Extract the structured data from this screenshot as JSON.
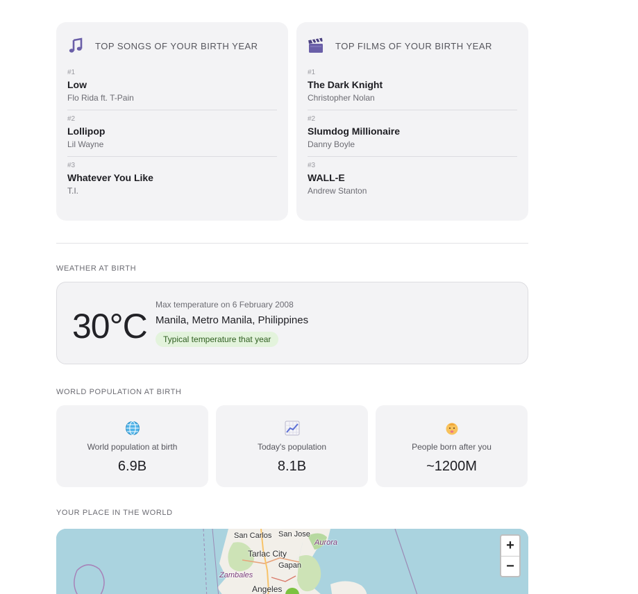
{
  "songs": {
    "title": "TOP SONGS OF YOUR BIRTH YEAR",
    "icon": "music-note-icon",
    "items": [
      {
        "rank": "#1",
        "title": "Low",
        "artist": "Flo Rida ft. T-Pain"
      },
      {
        "rank": "#2",
        "title": "Lollipop",
        "artist": "Lil Wayne"
      },
      {
        "rank": "#3",
        "title": "Whatever You Like",
        "artist": "T.I."
      }
    ]
  },
  "films": {
    "title": "TOP FILMS OF YOUR BIRTH YEAR",
    "icon": "clapperboard-icon",
    "items": [
      {
        "rank": "#1",
        "title": "The Dark Knight",
        "director": "Christopher Nolan"
      },
      {
        "rank": "#2",
        "title": "Slumdog Millionaire",
        "director": "Danny Boyle"
      },
      {
        "rank": "#3",
        "title": "WALL-E",
        "director": "Andrew Stanton"
      }
    ]
  },
  "weather": {
    "section_label": "WEATHER AT BIRTH",
    "temperature": "30°C",
    "description": "Max temperature on 6 February 2008",
    "location": "Manila, Metro Manila, Philippines",
    "badge": "Typical temperature that year",
    "badge_color": "#e3f3dc"
  },
  "population": {
    "section_label": "WORLD POPULATION AT BIRTH",
    "cards": [
      {
        "icon": "globe-icon",
        "label": "World population at birth",
        "value": "6.9B"
      },
      {
        "icon": "chart-increasing-icon",
        "label": "Today's population",
        "value": "8.1B"
      },
      {
        "icon": "baby-icon",
        "label": "People born after you",
        "value": "~1200M"
      }
    ]
  },
  "map": {
    "section_label": "YOUR PLACE IN THE WORLD",
    "zoom_in": "+",
    "zoom_out": "−",
    "places": [
      "San Carlos",
      "San Jose",
      "Aurora",
      "Tarlac City",
      "Gapan",
      "Zambales",
      "Angeles"
    ]
  }
}
